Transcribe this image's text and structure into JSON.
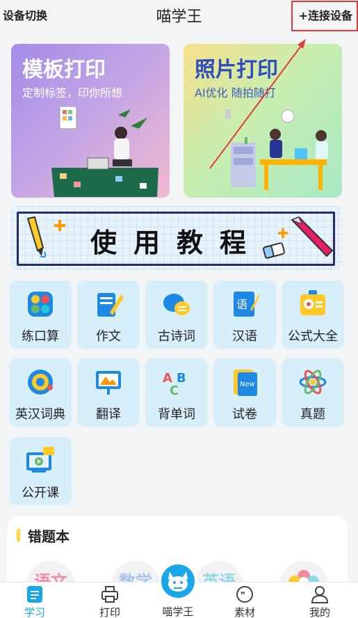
{
  "topbar": {
    "left_label": "设备切换",
    "title": "喵学王",
    "right_label": "+连接设备"
  },
  "banners": [
    {
      "title": "模板打印",
      "subtitle": "定制标签，印你所想"
    },
    {
      "title": "照片打印",
      "subtitle": "AI优化 随拍随打"
    }
  ],
  "tutorial": {
    "label": "使用教程"
  },
  "grid": [
    {
      "label": "练口算",
      "icon": "calc-icon"
    },
    {
      "label": "作文",
      "icon": "essay-icon"
    },
    {
      "label": "古诗词",
      "icon": "poem-icon"
    },
    {
      "label": "汉语",
      "icon": "chinese-icon"
    },
    {
      "label": "公式大全",
      "icon": "formula-icon"
    },
    {
      "label": "英汉词典",
      "icon": "dictionary-icon"
    },
    {
      "label": "翻译",
      "icon": "translate-icon"
    },
    {
      "label": "背单词",
      "icon": "words-icon"
    },
    {
      "label": "试卷",
      "icon": "exam-paper-icon"
    },
    {
      "label": "真题",
      "icon": "past-exam-icon"
    },
    {
      "label": "公开课",
      "icon": "open-class-icon"
    }
  ],
  "mistake_book": {
    "title": "错题本",
    "subjects": [
      "语文",
      "数学",
      "英语"
    ]
  },
  "tabbar": {
    "tabs": [
      {
        "label": "学习",
        "icon": "study-icon",
        "active": true
      },
      {
        "label": "打印",
        "icon": "printer-icon"
      },
      {
        "label": "喵学王",
        "icon": "cat-icon"
      },
      {
        "label": "素材",
        "icon": "material-icon"
      },
      {
        "label": "我的",
        "icon": "profile-icon"
      }
    ]
  },
  "colors": {
    "accent": "#1aa7e8",
    "tile_bg": "#d7eefb",
    "highlight_box": "#e23b3b",
    "mistake_bar": "#ffd54a"
  }
}
